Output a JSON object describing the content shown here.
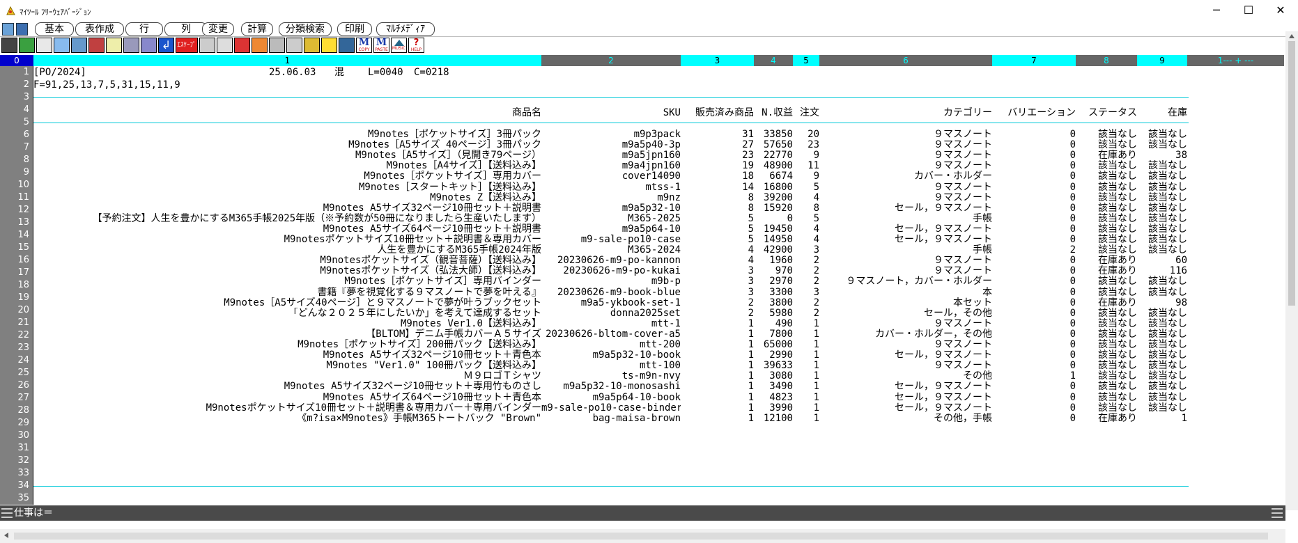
{
  "window": {
    "title": "ﾏｲﾂｰﾙ ﾌﾘｰｳｪｱﾊﾞｰｼﾞｮﾝ",
    "minimize": "─",
    "maximize": "☐",
    "close": "✕"
  },
  "menu": [
    "基本",
    "表作成",
    "行",
    "列",
    "変更",
    "計算",
    "分類検索",
    "印刷",
    "ﾏﾙﾁﾒﾃﾞｨｱ"
  ],
  "toolbar": {
    "eskape": "ｴｽｹｰﾌﾟ",
    "m1": "M",
    "m1_sub": "COPY",
    "m2": "M",
    "m2_sub": "PASTE",
    "music": "MUSIC",
    "help": "HELP"
  },
  "ruler": [
    "0",
    "1",
    "2",
    "3",
    "4",
    "5",
    "6",
    "7",
    "8",
    "9",
    "1--- + ---"
  ],
  "info": {
    "file": "[PO/2024]",
    "date": "25.06.03",
    "mode": "混",
    "line": "L=0040",
    "col": "C=0218",
    "format": "F=91,25,13,7,5,31,15,11,9"
  },
  "headers": [
    "商品名",
    "SKU",
    "販売済み商品",
    "N.収益",
    "注文",
    "カテゴリー",
    "バリエーション",
    "ステータス",
    "在庫"
  ],
  "rows": [
    [
      "M9notes［ポケットサイズ］3冊パック",
      "m9p3pack",
      "31",
      "33850",
      "20",
      "９マスノート",
      "0",
      "該当なし",
      "該当なし"
    ],
    [
      "M9notes［A5サイズ 40ページ］3冊パック",
      "m9a5p40-3p",
      "27",
      "57650",
      "23",
      "９マスノート",
      "0",
      "該当なし",
      "該当なし"
    ],
    [
      "M9notes［A5サイズ］（見開き79ページ）",
      "m9a5jpn160",
      "23",
      "22770",
      "9",
      "９マスノート",
      "0",
      "在庫あり",
      "38"
    ],
    [
      "M9notes［A4サイズ］【送料込み】",
      "m9a4jpn160",
      "19",
      "48900",
      "11",
      "９マスノート",
      "0",
      "該当なし",
      "該当なし"
    ],
    [
      "M9notes［ポケットサイズ］専用カバー",
      "cover14090",
      "18",
      "6674",
      "9",
      "カバー・ホルダー",
      "0",
      "該当なし",
      "該当なし"
    ],
    [
      "M9notes［スタートキット］【送料込み】",
      "mtss-1",
      "14",
      "16800",
      "5",
      "９マスノート",
      "0",
      "該当なし",
      "該当なし"
    ],
    [
      "M9notes Z【送料込み】",
      "m9nz",
      "8",
      "39200",
      "4",
      "９マスノート",
      "0",
      "該当なし",
      "該当なし"
    ],
    [
      "M9notes A5サイズ32ページ10冊セット＋説明書",
      "m9a5p32-10",
      "8",
      "15920",
      "8",
      "セール，９マスノート",
      "0",
      "該当なし",
      "該当なし"
    ],
    [
      "【予約注文】人生を豊かにするM365手帳2025年版（※予約数が50冊になりましたら生産いたします）",
      "M365-2025",
      "5",
      "0",
      "5",
      "手帳",
      "0",
      "該当なし",
      "該当なし"
    ],
    [
      "M9notes A5サイズ64ページ10冊セット＋説明書",
      "m9a5p64-10",
      "5",
      "19450",
      "4",
      "セール，９マスノート",
      "0",
      "該当なし",
      "該当なし"
    ],
    [
      "M9notesポケットサイズ10冊セット＋説明書＆専用カバー",
      "m9-sale-po10-case",
      "5",
      "14950",
      "4",
      "セール，９マスノート",
      "0",
      "該当なし",
      "該当なし"
    ],
    [
      "人生を豊かにするM365手帳2024年版",
      "M365-2024",
      "4",
      "42900",
      "3",
      "手帳",
      "2",
      "該当なし",
      "該当なし"
    ],
    [
      "M9notesポケットサイズ（観音菩薩）【送料込み】",
      "20230626-m9-po-kannon",
      "4",
      "1960",
      "2",
      "９マスノート",
      "0",
      "在庫あり",
      "60"
    ],
    [
      "M9notesポケットサイズ（弘法大師）【送料込み】",
      "20230626-m9-po-kukai",
      "3",
      "970",
      "2",
      "９マスノート",
      "0",
      "在庫あり",
      "116"
    ],
    [
      "M9notes［ポケットサイズ］専用バインダー",
      "m9b-p",
      "3",
      "2970",
      "2",
      "９マスノート，カバー・ホルダー",
      "0",
      "該当なし",
      "該当なし"
    ],
    [
      "書籍『夢を視覚化する９マスノートで夢を叶える』",
      "20230626-m9-book-blue",
      "3",
      "3300",
      "3",
      "本",
      "0",
      "該当なし",
      "該当なし"
    ],
    [
      "M9notes［A5サイズ40ページ］と９マスノートで夢が叶うブックセット",
      "m9a5-ykbook-set-1",
      "2",
      "3800",
      "2",
      "本セット",
      "0",
      "在庫あり",
      "98"
    ],
    [
      "「どんな２０２５年にしたいか」を考えて達成するセット",
      "donna2025set",
      "2",
      "5980",
      "2",
      "セール，その他",
      "0",
      "該当なし",
      "該当なし"
    ],
    [
      "M9notes Ver1.0【送料込み】",
      "mtt-1",
      "1",
      "490",
      "1",
      "９マスノート",
      "0",
      "該当なし",
      "該当なし"
    ],
    [
      "【BLTOM】デニム手帳カバーＡ５サイズ",
      "20230626-bltom-cover-a5",
      "1",
      "7800",
      "1",
      "カバー・ホルダー，その他",
      "0",
      "該当なし",
      "該当なし"
    ],
    [
      "M9notes［ポケットサイズ］200冊パック【送料込み】",
      "mtt-200",
      "1",
      "65000",
      "1",
      "９マスノート",
      "0",
      "該当なし",
      "該当なし"
    ],
    [
      "M9notes A5サイズ32ページ10冊セット＋青色本",
      "m9a5p32-10-book",
      "1",
      "2990",
      "1",
      "セール，９マスノート",
      "0",
      "該当なし",
      "該当なし"
    ],
    [
      "M9notes \"Ver1.0\" 100冊パック【送料込み】",
      "mtt-100",
      "1",
      "39633",
      "1",
      "９マスノート",
      "0",
      "該当なし",
      "該当なし"
    ],
    [
      "Ｍ９ロゴＴシャツ",
      "ts-m9n-nvy",
      "1",
      "3080",
      "1",
      "その他",
      "1",
      "該当なし",
      "該当なし"
    ],
    [
      "M9notes A5サイズ32ページ10冊セット＋専用竹ものさし",
      "m9a5p32-10-monosashi",
      "1",
      "3490",
      "1",
      "セール，９マスノート",
      "0",
      "該当なし",
      "該当なし"
    ],
    [
      "M9notes A5サイズ64ページ10冊セット＋青色本",
      "m9a5p64-10-book",
      "1",
      "4823",
      "1",
      "セール，９マスノート",
      "0",
      "該当なし",
      "該当なし"
    ],
    [
      "M9notesポケットサイズ10冊セット＋説明書＆専用カバー＋専用バインダー",
      "m9-sale-po10-case-binder",
      "1",
      "3990",
      "1",
      "セール，９マスノート",
      "0",
      "該当なし",
      "該当なし"
    ],
    [
      "《m?isa×M9notes》手帳M365トートバック \"Brown\"",
      "bag-maisa-brown",
      "1",
      "12100",
      "1",
      "その他，手帳",
      "0",
      "在庫あり",
      "1"
    ]
  ],
  "row_numbers": [
    "1",
    "2",
    "3",
    "4",
    "5",
    "6",
    "7",
    "8",
    "9",
    "10",
    "11",
    "12",
    "13",
    "14",
    "15",
    "16",
    "17",
    "18",
    "19",
    "20",
    "21",
    "22",
    "23",
    "24",
    "25",
    "26",
    "27",
    "28",
    "29",
    "30",
    "31",
    "32",
    "33",
    "34",
    "35"
  ],
  "status": {
    "label": "仕事は＝"
  }
}
